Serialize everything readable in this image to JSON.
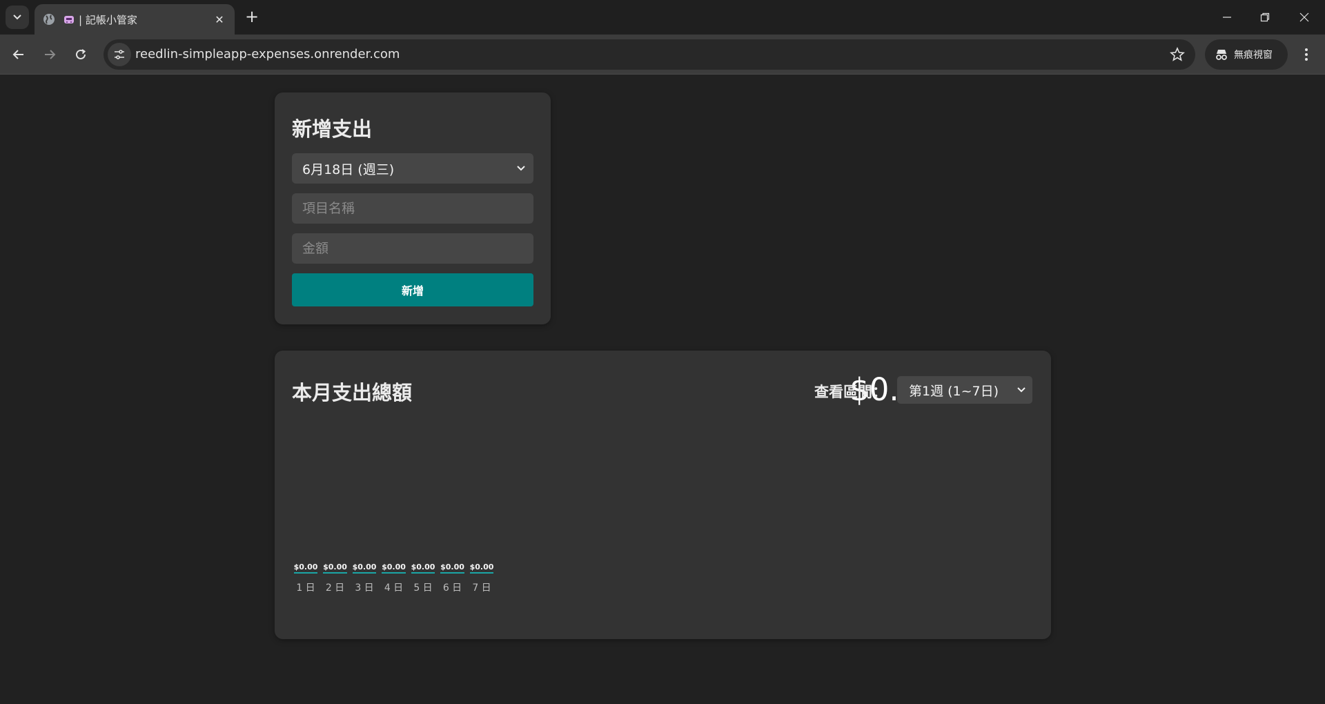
{
  "browser": {
    "tab_title": "| 記帳小管家",
    "url": "reedlin-simpleapp-expenses.onrender.com",
    "incognito_label": "無痕視窗"
  },
  "add_expense": {
    "title": "新增支出",
    "date_selected": "6月18日 (週三)",
    "item_placeholder": "項目名稱",
    "amount_placeholder": "金額",
    "submit_label": "新增"
  },
  "summary": {
    "title": "本月支出總額",
    "total": "$0.00",
    "range_label": "查看區間：",
    "range_selected": "第1週 (1~7日)"
  },
  "chart_data": {
    "type": "bar",
    "categories": [
      "1 日",
      "2 日",
      "3 日",
      "4 日",
      "5 日",
      "6 日",
      "7 日"
    ],
    "value_labels": [
      "$0.00",
      "$0.00",
      "$0.00",
      "$0.00",
      "$0.00",
      "$0.00",
      "$0.00"
    ],
    "values": [
      0,
      0,
      0,
      0,
      0,
      0,
      0
    ]
  },
  "colors": {
    "accent": "#008080",
    "card": "#333333",
    "background": "#212121"
  }
}
